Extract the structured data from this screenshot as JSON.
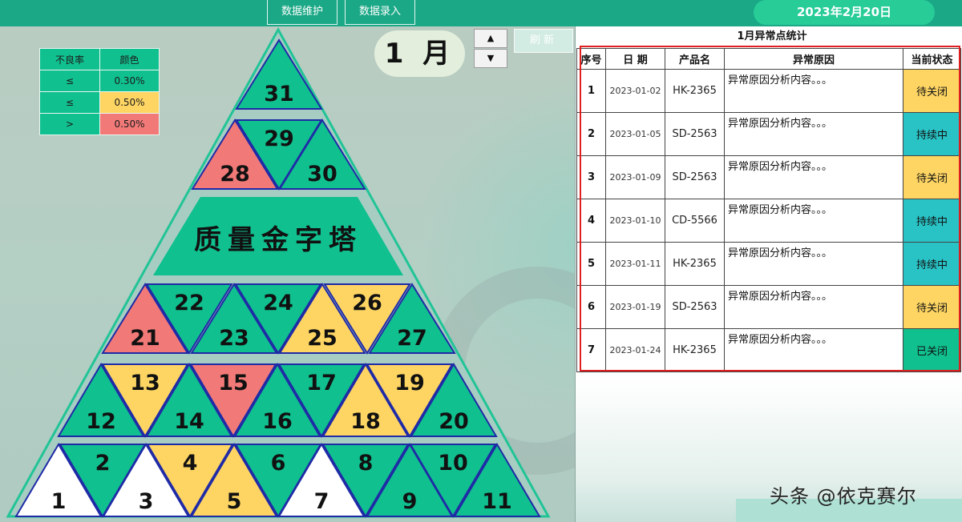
{
  "topbar": {
    "maintenance_label": "数据维护",
    "entry_label": "数据录入",
    "date": "2023年2月20日"
  },
  "legend": {
    "header": [
      "不良率",
      "颜色"
    ],
    "rows": [
      {
        "op": "≤",
        "value": "0.30%",
        "color": "#10c08f"
      },
      {
        "op": "≤",
        "value": "0.50%",
        "color": "#fed563"
      },
      {
        "op": ">",
        "value": "0.50%",
        "color": "#f17a78"
      }
    ]
  },
  "month": "1 月",
  "controls": {
    "up_icon": "▲",
    "down_icon": "▼",
    "refresh_label": "刷新"
  },
  "pyramid": {
    "title": "质量金字塔",
    "colors": {
      "green": "#10c08f",
      "yellow": "#fed563",
      "red": "#f17a78",
      "white": "#ffffff"
    },
    "cells": [
      {
        "day": "1",
        "status": "white"
      },
      {
        "day": "2",
        "status": "green"
      },
      {
        "day": "3",
        "status": "white"
      },
      {
        "day": "4",
        "status": "yellow"
      },
      {
        "day": "5",
        "status": "yellow"
      },
      {
        "day": "6",
        "status": "green"
      },
      {
        "day": "7",
        "status": "white"
      },
      {
        "day": "8",
        "status": "green"
      },
      {
        "day": "9",
        "status": "green"
      },
      {
        "day": "10",
        "status": "green"
      },
      {
        "day": "11",
        "status": "green"
      },
      {
        "day": "12",
        "status": "green"
      },
      {
        "day": "13",
        "status": "yellow"
      },
      {
        "day": "14",
        "status": "green"
      },
      {
        "day": "15",
        "status": "red"
      },
      {
        "day": "16",
        "status": "green"
      },
      {
        "day": "17",
        "status": "green"
      },
      {
        "day": "18",
        "status": "yellow"
      },
      {
        "day": "19",
        "status": "yellow"
      },
      {
        "day": "20",
        "status": "green"
      },
      {
        "day": "21",
        "status": "red"
      },
      {
        "day": "22",
        "status": "green"
      },
      {
        "day": "23",
        "status": "green"
      },
      {
        "day": "24",
        "status": "green"
      },
      {
        "day": "25",
        "status": "yellow"
      },
      {
        "day": "26",
        "status": "yellow"
      },
      {
        "day": "27",
        "status": "green"
      },
      {
        "day": "28",
        "status": "red"
      },
      {
        "day": "29",
        "status": "green"
      },
      {
        "day": "30",
        "status": "green"
      },
      {
        "day": "31",
        "status": "green"
      }
    ]
  },
  "stats": {
    "title": "1月异常点统计",
    "headers": [
      "序号",
      "日 期",
      "产品名",
      "异常原因",
      "当前状态"
    ],
    "rows": [
      {
        "idx": "1",
        "date": "2023-01-02",
        "product": "HK-2365",
        "reason": "异常原因分析内容。。。",
        "status": "待关闭",
        "status_color": "#fed563"
      },
      {
        "idx": "2",
        "date": "2023-01-05",
        "product": "SD-2563",
        "reason": "异常原因分析内容。。。",
        "status": "持续中",
        "status_color": "#29c3c6"
      },
      {
        "idx": "3",
        "date": "2023-01-09",
        "product": "SD-2563",
        "reason": "异常原因分析内容。。。",
        "status": "待关闭",
        "status_color": "#fed563"
      },
      {
        "idx": "4",
        "date": "2023-01-10",
        "product": "CD-5566",
        "reason": "异常原因分析内容。。。",
        "status": "持续中",
        "status_color": "#29c3c6"
      },
      {
        "idx": "5",
        "date": "2023-01-11",
        "product": "HK-2365",
        "reason": "异常原因分析内容。。。",
        "status": "持续中",
        "status_color": "#29c3c6"
      },
      {
        "idx": "6",
        "date": "2023-01-19",
        "product": "SD-2563",
        "reason": "异常原因分析内容。。。",
        "status": "待关闭",
        "status_color": "#fed563"
      },
      {
        "idx": "7",
        "date": "2023-01-24",
        "product": "HK-2365",
        "reason": "异常原因分析内容。。。",
        "status": "已关闭",
        "status_color": "#10c08f"
      }
    ]
  },
  "watermark": "头条 @依克赛尔"
}
